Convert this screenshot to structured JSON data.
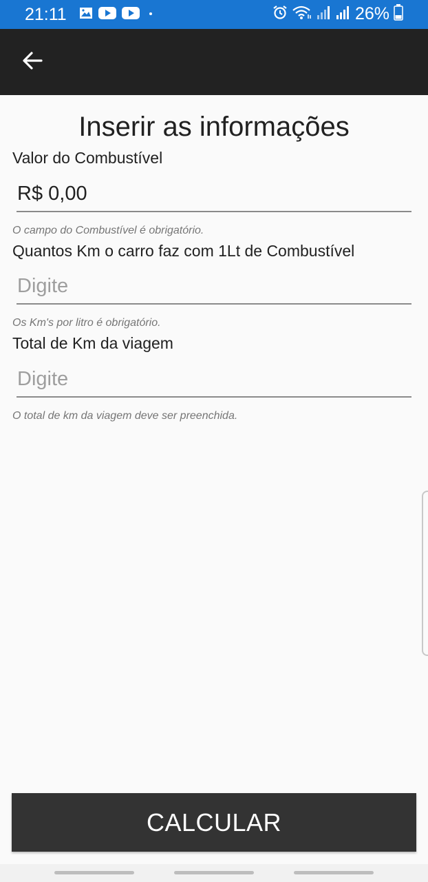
{
  "status_bar": {
    "time": "21:11",
    "battery": "26%",
    "left_icons": [
      "gallery-icon",
      "youtube-icon",
      "youtube-icon",
      "dot-icon"
    ],
    "right_icons": [
      "alarm-icon",
      "wifi-icon",
      "signal-icon",
      "signal-icon",
      "battery-icon"
    ],
    "color": "#1976d2"
  },
  "app_bar": {
    "back_icon": "arrow-left-icon",
    "color": "#222222"
  },
  "form": {
    "title": "Inserir as informações",
    "fuel_price": {
      "label": "Valor do Combustível",
      "value": "R$ 0,00",
      "error": "O campo do Combustível é obrigatório."
    },
    "km_per_liter": {
      "label": "Quantos Km o carro faz com 1Lt de Combustível",
      "placeholder": "Digite",
      "error": "Os Km's por litro é obrigatório."
    },
    "trip_km": {
      "label": "Total de Km da viagem",
      "placeholder": "Digite",
      "error": "O total de km da viagem deve ser preenchida."
    }
  },
  "button": {
    "calculate_label": "CALCULAR"
  }
}
